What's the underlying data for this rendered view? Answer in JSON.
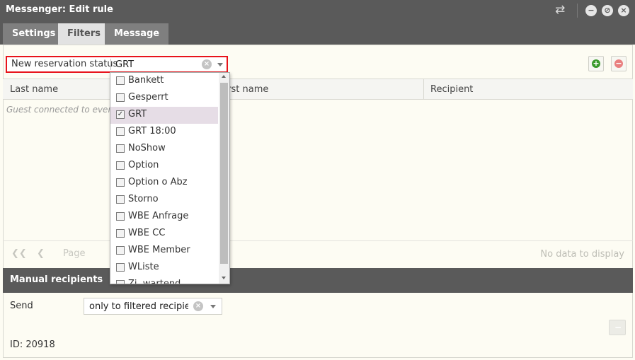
{
  "window": {
    "title": "Messenger: Edit rule",
    "controls": [
      "swap-icon",
      "minimize-icon",
      "maximize-icon",
      "close-icon"
    ]
  },
  "tabs": [
    {
      "label": "Settings",
      "active": false
    },
    {
      "label": "Filters",
      "active": true
    },
    {
      "label": "Message",
      "active": false
    }
  ],
  "filter": {
    "label": "New reservation status",
    "value": "GRT",
    "clear_glyph": "×"
  },
  "toolbar": {
    "add_glyph": "+",
    "remove_glyph": "−"
  },
  "grid": {
    "columns": [
      "Last name",
      "First name",
      "Recipient"
    ],
    "empty_text": "Guest connected to event"
  },
  "pager": {
    "first_glyph": "❮❮",
    "prev_glyph": "❮",
    "page_label": "Page",
    "no_data": "No data to display"
  },
  "dropdown": {
    "options": [
      {
        "label": "Bankett",
        "checked": false
      },
      {
        "label": "Gesperrt",
        "checked": false
      },
      {
        "label": "GRT",
        "checked": true
      },
      {
        "label": "GRT 18:00",
        "checked": false
      },
      {
        "label": "NoShow",
        "checked": false
      },
      {
        "label": "Option",
        "checked": false
      },
      {
        "label": "Option o Abz",
        "checked": false
      },
      {
        "label": "Storno",
        "checked": false
      },
      {
        "label": "WBE Anfrage",
        "checked": false
      },
      {
        "label": "WBE CC",
        "checked": false
      },
      {
        "label": "WBE Member",
        "checked": false
      },
      {
        "label": "WListe",
        "checked": false
      },
      {
        "label": "Zi. wartend",
        "checked": false
      }
    ]
  },
  "manual": {
    "title": "Manual recipients",
    "send_label": "Send",
    "send_value": "only to filtered recipients",
    "id_text": "ID: 20918",
    "remove_glyph": "−"
  },
  "colors": {
    "titlebar": "#5a5a5a",
    "highlight_border": "#e8131a",
    "background": "#fdfcf3",
    "add_green": "#3a9a2c",
    "remove_red": "#e98080"
  }
}
